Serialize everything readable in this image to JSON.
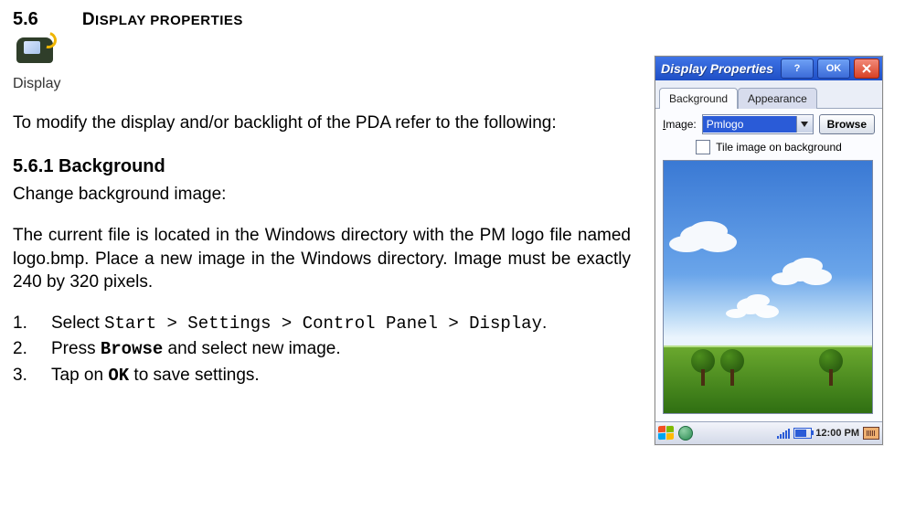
{
  "heading": {
    "number": "5.6",
    "title_first": "D",
    "title_rest": "ISPLAY PROPERTIES"
  },
  "icon_caption": "Display",
  "intro": "To modify the display and/or backlight of the PDA refer to the following:",
  "subhead": "5.6.1 Background",
  "lead": "Change background image:",
  "para": "The current file is located in the Windows directory with the PM logo file named logo.bmp. Place a new image in the Windows directory. Image must be exactly 240 by 320 pixels.",
  "steps": {
    "s1": {
      "num": "1.",
      "pre": "Select ",
      "path": "Start > Settings > Control Panel > Display",
      "post": "."
    },
    "s2": {
      "num": "2.",
      "pre": "Press ",
      "b": "Browse",
      "post": " and select new image."
    },
    "s3": {
      "num": "3.",
      "pre": "Tap on ",
      "b": "OK",
      "post": " to save settings."
    }
  },
  "pda": {
    "title": "Display Properties",
    "help": "?",
    "ok": "OK",
    "tabs": {
      "background": "Background",
      "appearance": "Appearance"
    },
    "image_label_u": "I",
    "image_label_rest": "mage:",
    "image_value": "Pmlogo",
    "browse": "Browse",
    "tile_label": "Tile image on background",
    "clock": "12:00 PM"
  }
}
